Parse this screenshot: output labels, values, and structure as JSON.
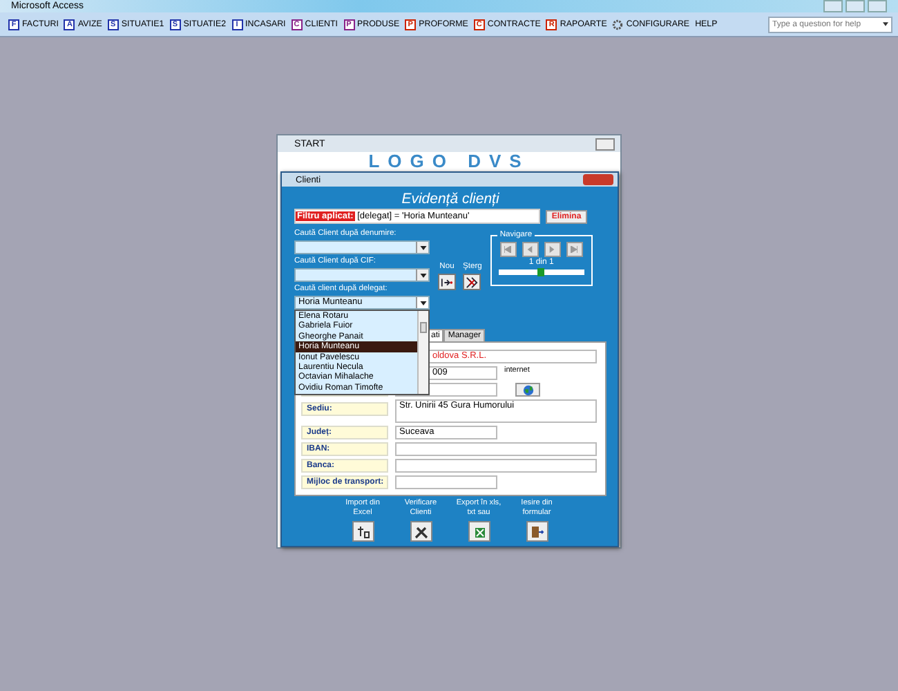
{
  "app_title": "Microsoft Access",
  "menu": [
    {
      "label": "FACTURI",
      "kind": "letter",
      "icon_text": "F",
      "color": "#2233aa"
    },
    {
      "label": "AVIZE",
      "kind": "letter",
      "icon_text": "A",
      "color": "#2233aa"
    },
    {
      "label": "SITUATIE1",
      "kind": "letter",
      "icon_text": "S",
      "color": "#2233aa"
    },
    {
      "label": "SITUATIE2",
      "kind": "letter",
      "icon_text": "S",
      "color": "#2233aa"
    },
    {
      "label": "INCASARI",
      "kind": "letter",
      "icon_text": "I",
      "color": "#2233aa"
    },
    {
      "label": "CLIENTI",
      "kind": "letter",
      "icon_text": "C",
      "color": "#882288"
    },
    {
      "label": "PRODUSE",
      "kind": "letter",
      "icon_text": "P",
      "color": "#882288"
    },
    {
      "label": "PROFORME",
      "kind": "letter",
      "icon_text": "P",
      "color": "#cc2200"
    },
    {
      "label": "CONTRACTE",
      "kind": "letter",
      "icon_text": "C",
      "color": "#cc2200"
    },
    {
      "label": "RAPOARTE",
      "kind": "letter",
      "icon_text": "R",
      "color": "#cc2200"
    },
    {
      "label": "CONFIGURARE",
      "kind": "gear"
    },
    {
      "label": "HELP",
      "kind": "none"
    }
  ],
  "help_box": {
    "placeholder": "Type a question for help"
  },
  "start_window": {
    "title": "START",
    "logo": "LOGO DVS"
  },
  "form": {
    "title": "Clienti",
    "heading": "Evidență clienți",
    "filter": {
      "label": "Filtru aplicat:",
      "value": "[delegat] = 'Horia Munteanu'",
      "button": "Elimina"
    },
    "searches": [
      {
        "label": "Caută Client după denumire:",
        "open": false
      },
      {
        "label": "Caută Client după CIF:",
        "open": false
      },
      {
        "label": "Caută client după delegat:",
        "value": "Horia Munteanu",
        "open": true
      }
    ],
    "dropdown_items": [
      {
        "label": "Elena Rotaru",
        "selected": false
      },
      {
        "label": "Gabriela Fuior",
        "selected": false
      },
      {
        "label": "Gheorghe Panait",
        "selected": false
      },
      {
        "label": "Horia Munteanu",
        "selected": true
      },
      {
        "label": "Ionut Pavelescu",
        "selected": false
      },
      {
        "label": "Laurentiu Necula",
        "selected": false
      },
      {
        "label": "Octavian Mihalache",
        "selected": false
      },
      {
        "label": "Ovidiu Roman Timofte",
        "selected": false
      }
    ],
    "actions": [
      {
        "label": "Nou",
        "kind": "new"
      },
      {
        "label": "Şterg",
        "kind": "delete"
      }
    ],
    "navigation": {
      "title": "Navigare",
      "record": "1 din 1",
      "level": 0.5
    },
    "tabs": [
      {
        "label": "ati",
        "selected": true
      },
      {
        "label": "Manager",
        "selected": false
      }
    ],
    "fields": [
      {
        "value": "oldova S.R.L.",
        "highlight": true,
        "tall": false
      },
      {
        "value": "009",
        "highlight": false,
        "tall": false
      },
      {
        "tall": false
      },
      {
        "label": "Sediu:",
        "value": "Str. Unirii 45 Gura Humorului",
        "highlight": false,
        "tall": true
      },
      {
        "label": "Județ:",
        "value": "Suceava",
        "highlight": false,
        "tall": false
      },
      {
        "label": "IBAN:",
        "tall": false
      },
      {
        "label": "Banca:",
        "tall": false
      },
      {
        "label": "Mijloc de transport:",
        "tall": false
      }
    ],
    "internet_label": "internet",
    "bottom_buttons": [
      {
        "label": "Import din Excel",
        "kind": "import"
      },
      {
        "label": "Verificare Clienti",
        "kind": "tools"
      },
      {
        "label": "Export în xls, txt sau",
        "kind": "export"
      },
      {
        "label": "Iesire din formular",
        "kind": "exit"
      }
    ]
  }
}
